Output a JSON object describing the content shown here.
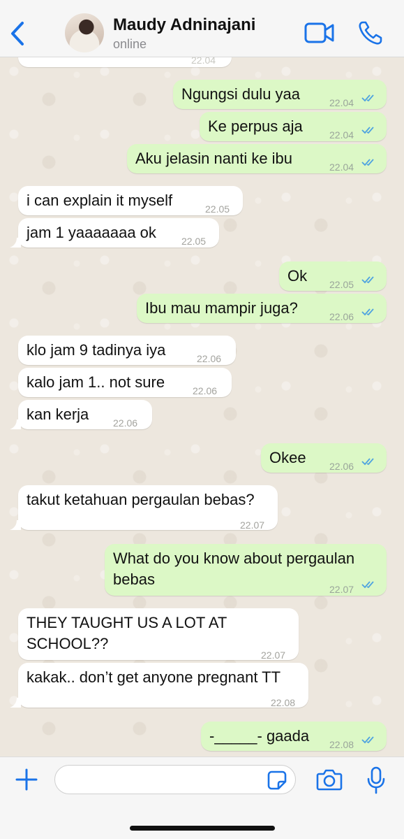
{
  "header": {
    "name": "Maudy Adninajani",
    "status": "online"
  },
  "messages": [
    {
      "dir": "in",
      "text": "",
      "time": "22.04"
    },
    {
      "dir": "out",
      "text": "Ngungsi dulu yaa",
      "time": "22.04"
    },
    {
      "dir": "out",
      "text": "Ke perpus aja",
      "time": "22.04"
    },
    {
      "dir": "out",
      "text": "Aku jelasin nanti ke ibu",
      "time": "22.04"
    },
    {
      "dir": "in",
      "text": "i can explain it myself",
      "time": "22.05"
    },
    {
      "dir": "in",
      "text": "jam 1 yaaaaaaa ok",
      "time": "22.05"
    },
    {
      "dir": "out",
      "text": "Ok",
      "time": "22.05"
    },
    {
      "dir": "out",
      "text": "Ibu mau mampir juga?",
      "time": "22.06"
    },
    {
      "dir": "in",
      "text": "klo jam 9 tadinya iya",
      "time": "22.06"
    },
    {
      "dir": "in",
      "text": "kalo jam 1.. not sure",
      "time": "22.06"
    },
    {
      "dir": "in",
      "text": "kan kerja",
      "time": "22.06"
    },
    {
      "dir": "out",
      "text": "Okee",
      "time": "22.06"
    },
    {
      "dir": "in",
      "text": "takut ketahuan pergaulan bebas?",
      "time": "22.07"
    },
    {
      "dir": "out",
      "text": "What do you know about pergaulan",
      "text2": "bebas",
      "time": "22.07"
    },
    {
      "dir": "in",
      "text": "THEY TAUGHT US A LOT AT",
      "text2": "SCHOOL??",
      "time": "22.07"
    },
    {
      "dir": "in",
      "text": "kakak.. don’t get anyone pregnant TT",
      "time": "22.08"
    },
    {
      "dir": "out",
      "text": "-_____- gaada",
      "time": "22.08"
    }
  ],
  "composer": {
    "placeholder": ""
  },
  "icons": {
    "back": "chevron-left-icon",
    "video": "video-camera-icon",
    "call": "phone-icon",
    "plus": "plus-icon",
    "sticker": "sticker-icon",
    "camera": "camera-icon",
    "mic": "microphone-icon",
    "read": "double-check-icon"
  },
  "colors": {
    "accent": "#1a73e8",
    "outgoing_bubble": "#dcf8c6",
    "incoming_bubble": "#ffffff",
    "chat_background": "#ede7de",
    "read_ticks": "#4fa3e0"
  }
}
